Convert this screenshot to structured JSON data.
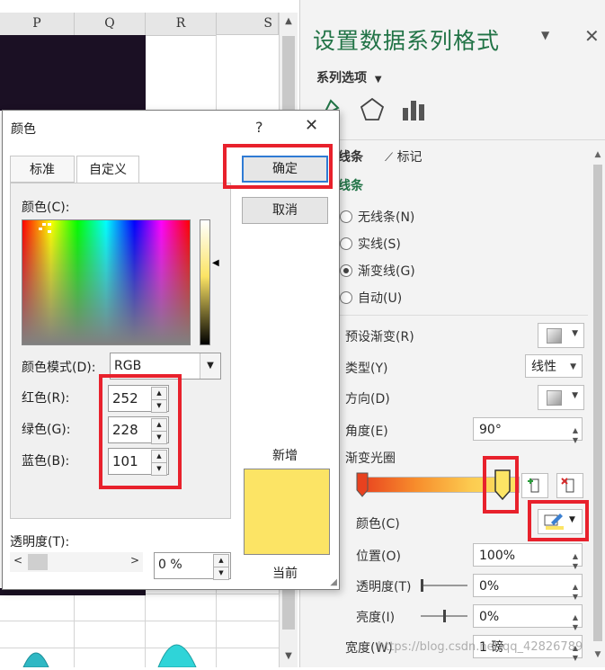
{
  "spreadsheet": {
    "columns": [
      "P",
      "Q",
      "R",
      "S"
    ]
  },
  "panel": {
    "title": "设置数据系列格式",
    "series_options": "系列选项",
    "tabs": {
      "line": "线条",
      "marker": "标记"
    },
    "section": "线条",
    "radios": [
      "无线条(N)",
      "实线(S)",
      "渐变线(G)",
      "自动(U)"
    ],
    "checked_radio": "渐变线(G)",
    "preset": "预设渐变(R)",
    "type": {
      "label": "类型(Y)",
      "value": "线性"
    },
    "direction": "方向(D)",
    "angle": {
      "label": "角度(E)",
      "value": "90°"
    },
    "stops_label": "渐变光圈",
    "color_label": "颜色(C)",
    "position": {
      "label": "位置(O)",
      "value": "100%"
    },
    "transparency": {
      "label": "透明度(T)",
      "value": "0%"
    },
    "brightness": {
      "label": "亮度(I)",
      "value": "0%"
    },
    "width": {
      "label": "宽度(W)",
      "value": "1 磅"
    },
    "watermark": "https://blog.csdn.net/qq_42826789"
  },
  "dialog": {
    "title": "颜色",
    "help": "?",
    "tabs": [
      "标准",
      "自定义"
    ],
    "active_tab": "自定义",
    "colors_label": "颜色(C):",
    "mode_label": "颜色模式(D):",
    "mode_value": "RGB",
    "red": {
      "label": "红色(R):",
      "value": "252"
    },
    "green": {
      "label": "绿色(G):",
      "value": "228"
    },
    "blue": {
      "label": "蓝色(B):",
      "value": "101"
    },
    "ok": "确定",
    "cancel": "取消",
    "new": "新增",
    "current": "当前",
    "transparency_label": "透明度(T):",
    "transparency_value": "0 %",
    "selected_color": "#fce465"
  },
  "accent_color": "#217346",
  "highlight_color": "#e8212c"
}
